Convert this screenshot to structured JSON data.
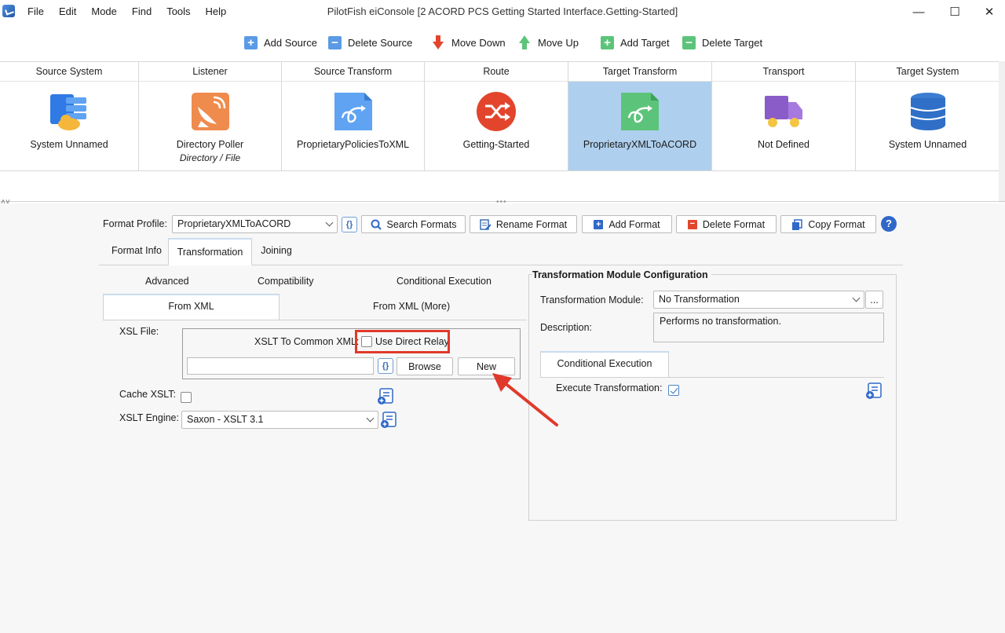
{
  "window": {
    "title": "PilotFish eiConsole [2 ACORD PCS Getting Started Interface.Getting-Started]",
    "menu": [
      "File",
      "Edit",
      "Mode",
      "Find",
      "Tools",
      "Help"
    ],
    "controls": {
      "minimize": "—",
      "maximize": "☐",
      "close": "✕"
    }
  },
  "toolbar": {
    "add_source": "Add Source",
    "delete_source": "Delete Source",
    "move_down": "Move Down",
    "move_up": "Move Up",
    "add_target": "Add Target",
    "delete_target": "Delete Target"
  },
  "stages": [
    {
      "header": "Source System",
      "label": "System Unnamed",
      "sub": "",
      "icon": "source-system-icon"
    },
    {
      "header": "Listener",
      "label": "Directory Poller",
      "sub": "Directory / File",
      "icon": "listener-satellite-icon"
    },
    {
      "header": "Source Transform",
      "label": "ProprietaryPoliciesToXML",
      "sub": "",
      "icon": "transform-doc-icon"
    },
    {
      "header": "Route",
      "label": "Getting-Started",
      "sub": "",
      "icon": "route-shuffle-icon"
    },
    {
      "header": "Target Transform",
      "label": "ProprietaryXMLToACORD",
      "sub": "",
      "icon": "transform-doc-green-icon",
      "selected": true
    },
    {
      "header": "Transport",
      "label": "Not Defined",
      "sub": "",
      "icon": "transport-truck-icon"
    },
    {
      "header": "Target System",
      "label": "System Unnamed",
      "sub": "",
      "icon": "database-icon"
    }
  ],
  "format": {
    "label": "Format Profile:",
    "value": "ProprietaryXMLToACORD",
    "search": "Search Formats",
    "rename": "Rename Format",
    "add": "Add Format",
    "delete": "Delete Format",
    "copy": "Copy Format",
    "help": "?"
  },
  "tabs": {
    "format_info": "Format Info",
    "transformation": "Transformation",
    "joining": "Joining"
  },
  "subtabs": {
    "advanced": "Advanced",
    "compatibility": "Compatibility",
    "conditional_execution": "Conditional Execution",
    "from_xml": "From XML",
    "from_xml_more": "From XML (More)"
  },
  "xsl": {
    "file_label": "XSL File:",
    "xslt_common_label": "XSLT To Common XML:",
    "direct_relay": "Use Direct Relay",
    "path_value": "",
    "browse": "Browse",
    "new": "New",
    "cache_label": "Cache XSLT:",
    "engine_label": "XSLT Engine:",
    "engine_value": "Saxon - XSLT 3.1"
  },
  "config": {
    "title": "Transformation Module Configuration",
    "module_label": "Transformation Module:",
    "module_value": "No Transformation",
    "more": "...",
    "desc_label": "Description:",
    "desc_value": "Performs no transformation.",
    "ce_tab": "Conditional Execution",
    "exec_label": "Execute Transformation:"
  },
  "colors": {
    "selected_stage": "#aecfed",
    "highlight": "#e0392b",
    "accent": "#2f68c9"
  }
}
